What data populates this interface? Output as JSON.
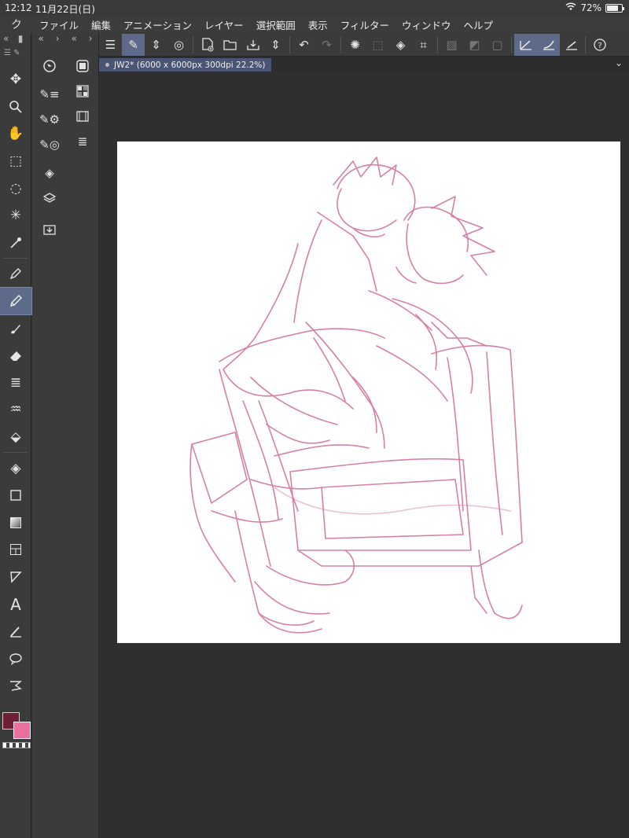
{
  "status": {
    "time": "12:12",
    "date": "11月22日(日)",
    "battery": "72%"
  },
  "menu": {
    "logo": "ク",
    "items": [
      "ファイル",
      "編集",
      "アニメーション",
      "レイヤー",
      "選択範囲",
      "表示",
      "フィルター",
      "ウィンドウ",
      "ヘルプ"
    ]
  },
  "document": {
    "tab_title": "JW2* (6000 x 6000px 300dpi 22.2%)"
  },
  "colors": {
    "main": "#6d1f33",
    "sub": "#e86f9e",
    "accent": "#5e6a8a",
    "sketch": "#d06a98"
  },
  "tools": [
    "move",
    "zoom",
    "hand",
    "object",
    "lasso-select",
    "auto-select",
    "eyedropper",
    "pen",
    "pencil",
    "brush",
    "eraser",
    "blend",
    "fill",
    "figure",
    "gradient",
    "frame",
    "ruler",
    "text",
    "correct-line",
    "balloon",
    "flow-line"
  ],
  "active_tool": "pencil"
}
